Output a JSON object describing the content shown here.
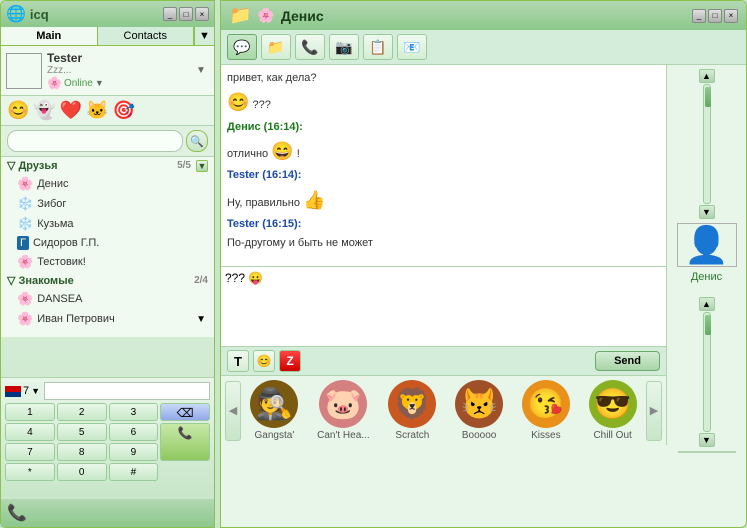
{
  "icq": {
    "title": "icq",
    "tabs": [
      {
        "label": "Main",
        "active": true
      },
      {
        "label": "Contacts",
        "active": false
      }
    ],
    "me": {
      "name": "Tester",
      "status_text": "Zzz...",
      "status": "Online"
    },
    "moods": [
      "😊",
      "👻",
      "❤️",
      "🐱",
      "🎯"
    ],
    "search_placeholder": "",
    "groups": [
      {
        "name": "Друзья",
        "count": "5/5",
        "contacts": [
          {
            "name": "Денис",
            "icon": "🌸"
          },
          {
            "name": "Зибог",
            "icon": "❄️"
          },
          {
            "name": "Кузьма",
            "icon": "❄️"
          },
          {
            "name": "Сидоров Г.П.",
            "icon": "🅰️"
          },
          {
            "name": "Тестовик!",
            "icon": "🌸"
          }
        ]
      },
      {
        "name": "Знакомые",
        "count": "2/4",
        "contacts": [
          {
            "name": "DANSEA",
            "icon": "🌸"
          },
          {
            "name": "Иван Петрович",
            "icon": "🌸"
          }
        ]
      }
    ],
    "phone": {
      "country_code": "7",
      "buttons": [
        "1",
        "2",
        "3",
        "4",
        "5",
        "6",
        "7",
        "8",
        "9",
        "*",
        "0",
        "#"
      ]
    },
    "win_buttons": [
      "_",
      "□",
      "×"
    ]
  },
  "chat": {
    "title": "Денис",
    "toolbar_buttons": [
      {
        "icon": "💬",
        "label": "history"
      },
      {
        "icon": "📁",
        "label": "files"
      },
      {
        "icon": "📞",
        "label": "call"
      },
      {
        "icon": "📹",
        "label": "video"
      },
      {
        "icon": "📋",
        "label": "info"
      },
      {
        "icon": "📧",
        "label": "email"
      }
    ],
    "messages": [
      {
        "type": "text",
        "text": "привет, как дела?",
        "sender": "",
        "bold": false
      },
      {
        "type": "emoji_text",
        "emoji": "😊",
        "text": "???",
        "sender": ""
      },
      {
        "type": "sender",
        "sender": "Денис (16:14):",
        "sender_type": "denis"
      },
      {
        "type": "emoji_text",
        "text": "отлично",
        "emoji": "😄",
        "extra": "!",
        "sender": ""
      },
      {
        "type": "sender",
        "sender": "Tester (16:14):",
        "sender_type": "tester"
      },
      {
        "type": "emoji_text",
        "text": "Ну, правильно",
        "emoji": "👍",
        "sender": ""
      },
      {
        "type": "sender",
        "sender": "Tester (16:15):",
        "sender_type": "tester"
      },
      {
        "type": "text",
        "text": "По-другому и быть не может",
        "sender": ""
      }
    ],
    "input_text": "??? 😛",
    "send_button": "Send",
    "contact_right": {
      "name": "Денис"
    },
    "smileys": [
      {
        "label": "Gangsta'",
        "bg": "#8B6914",
        "emoji": "🎩"
      },
      {
        "label": "Can't Hea...",
        "bg": "#e88080",
        "emoji": "🐷"
      },
      {
        "label": "Scratch",
        "bg": "#e86020",
        "emoji": "🐱"
      },
      {
        "label": "Booooo",
        "bg": "#c06030",
        "emoji": "😾"
      },
      {
        "label": "Kisses",
        "bg": "#e8a020",
        "emoji": "😘"
      },
      {
        "label": "Chill Out",
        "bg": "#a0c830",
        "emoji": "😎"
      }
    ],
    "win_buttons": [
      "_",
      "□",
      "×"
    ]
  }
}
